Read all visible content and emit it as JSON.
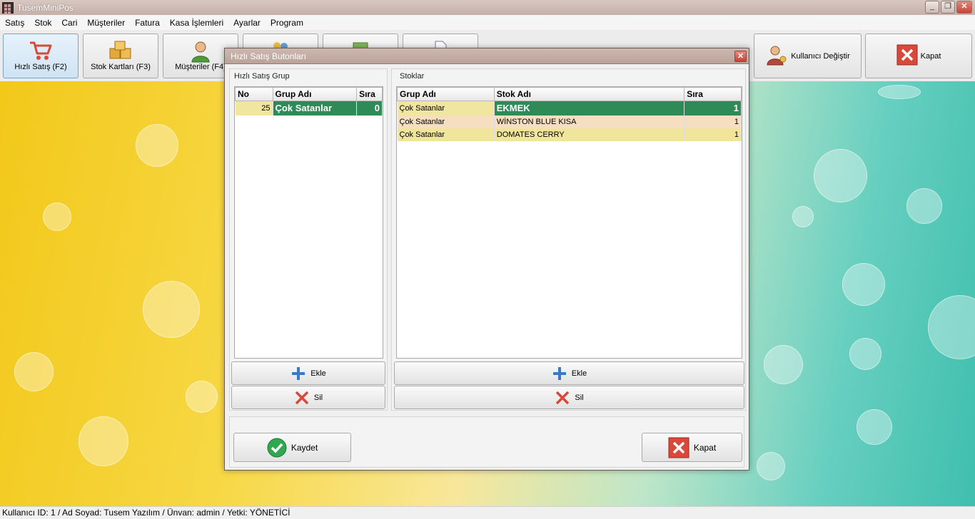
{
  "window": {
    "title": "TusemMiniPos"
  },
  "menu": [
    "Satış",
    "Stok",
    "Cari",
    "Müşteriler",
    "Fatura",
    "Kasa İşlemleri",
    "Ayarlar",
    "Program"
  ],
  "toolbar": {
    "quick_sale": "Hızlı Satış (F2)",
    "stock_cards": "Stok Kartları (F3)",
    "customers": "Müşteriler (F4)",
    "change_user": "Kullanıcı Değiştir",
    "close": "Kapat"
  },
  "dialog": {
    "title": "Hızlı Satış Butonları",
    "group_panel": {
      "label": "Hızlı Satış Grup",
      "columns": [
        "No",
        "Grup Adı",
        "Sıra"
      ],
      "rows": [
        {
          "no": "25",
          "name": "Çok Satanlar",
          "order": "0"
        }
      ]
    },
    "stock_panel": {
      "label": "Stoklar",
      "columns": [
        "Grup Adı",
        "Stok Adı",
        "Sıra"
      ],
      "rows": [
        {
          "group": "Çok Satanlar",
          "stock": "EKMEK",
          "order": "1"
        },
        {
          "group": "Çok Satanlar",
          "stock": "WİNSTON BLUE KISA",
          "order": "1"
        },
        {
          "group": "Çok Satanlar",
          "stock": "DOMATES CERRY",
          "order": "1"
        }
      ]
    },
    "add_label": "Ekle",
    "delete_label": "Sil",
    "save_label": "Kaydet",
    "close_label": "Kapat"
  },
  "status": {
    "text": "Kullanıcı ID: 1 / Ad Soyad: Tusem Yazılım / Ünvan: admin / Yetki: YÖNETİCİ"
  },
  "colors": {
    "selected_row": "#2e8a57",
    "row_yellow": "#f1e59c",
    "row_peach": "#f6dfc0",
    "accent_blue": "#3d78c4",
    "danger_red": "#d9483b"
  }
}
